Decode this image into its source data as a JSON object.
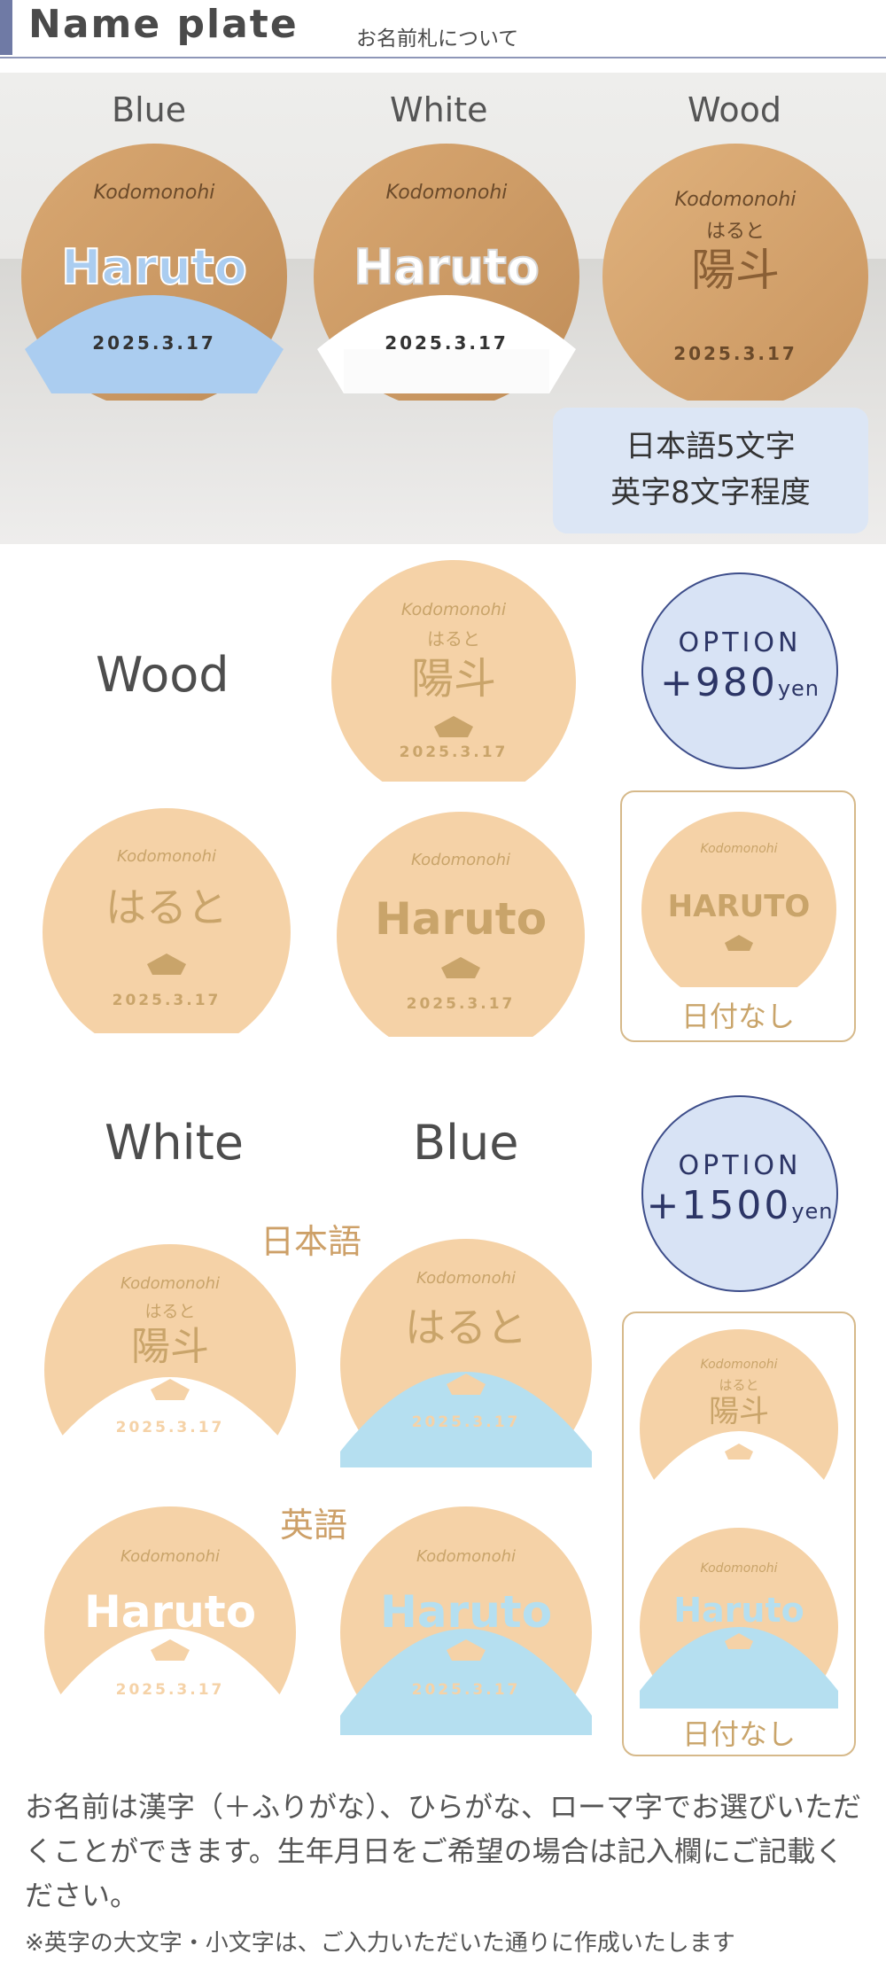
{
  "header": {
    "title": "Name plate",
    "subtitle": "お名前札について"
  },
  "photo": {
    "labels": [
      "Blue",
      "White",
      "Wood"
    ],
    "plate_brand": "Kodomonohi",
    "plate_name_en": "Haruto",
    "plate_name_kana": "はると",
    "plate_name_kanji": "陽斗",
    "plate_date": "2025.3.17",
    "badge_line1": "日本語5文字",
    "badge_line2": "英字8文字程度"
  },
  "wood_section": {
    "label": "Wood",
    "option": {
      "line1": "OPTION",
      "price": "+980",
      "unit": "yen"
    },
    "no_date_caption": "日付なし",
    "plates": [
      {
        "kana": "はると",
        "kanji": "陽斗",
        "date": "2025.3.17"
      },
      {
        "kana": "はると",
        "date": "2025.3.17"
      },
      {
        "en": "Haruto",
        "date": "2025.3.17"
      },
      {
        "en_caps": "HARUTO"
      }
    ]
  },
  "color_section": {
    "label_white": "White",
    "label_blue": "Blue",
    "lang_jp": "日本語",
    "lang_en": "英語",
    "option": {
      "line1": "OPTION",
      "price": "+1500",
      "unit": "yen"
    },
    "no_date_caption": "日付なし"
  },
  "description": "お名前は漢字（＋ふりがな）、ひらがな、ローマ字でお選びいただくことができます。生年月日をご希望の場合は記入欄にご記載ください。",
  "note": "※英字の大文字・小文字は、ご入力いただいた通りに作成いたします",
  "colors": {
    "wood": "#f5d2a7",
    "blue": "#b5dff0",
    "engrave": "#c9a46a",
    "accent": "#3d4d8a"
  }
}
